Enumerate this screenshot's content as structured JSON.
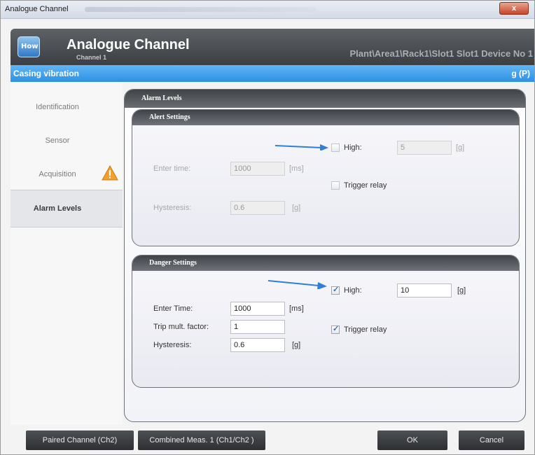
{
  "window": {
    "title": "Analogue Channel",
    "close_label": "x"
  },
  "header": {
    "logo_text": "How",
    "title": "Analogue Channel",
    "subtitle": "Channel 1",
    "path": "Plant\\Area1\\Rack1\\Slot1 Slot1 Device No 1"
  },
  "strip": {
    "left": "Casing vibration",
    "right": "g (P)"
  },
  "sidebar": {
    "items": [
      {
        "label": "Identification"
      },
      {
        "label": "Sensor"
      },
      {
        "label": "Acquisition"
      },
      {
        "label": "Alarm Levels"
      }
    ]
  },
  "main": {
    "title": "Alarm Levels",
    "alert": {
      "title": "Alert Settings",
      "high_label": "High:",
      "high_value": "5",
      "high_unit": "[g]",
      "high_checked": false,
      "enter_time_label": "Enter time:",
      "enter_time_value": "1000",
      "enter_time_unit": "[ms]",
      "trigger_relay_label": "Trigger relay",
      "hysteresis_label": "Hysteresis:",
      "hysteresis_value": "0.6",
      "hysteresis_unit": "[g]"
    },
    "danger": {
      "title": "Danger Settings",
      "high_label": "High:",
      "high_value": "10",
      "high_unit": "[g]",
      "high_checked": true,
      "enter_time_label": "Enter Time:",
      "enter_time_value": "1000",
      "enter_time_unit": "[ms]",
      "trip_label": "Trip mult. factor:",
      "trip_value": "1",
      "trigger_relay_label": "Trigger relay",
      "trigger_relay_checked": true,
      "hysteresis_label": "Hysteresis:",
      "hysteresis_value": "0.6",
      "hysteresis_unit": "[g]"
    }
  },
  "footer": {
    "paired": "Paired Channel (Ch2)",
    "combined": "Combined Meas. 1 (Ch1/Ch2 )",
    "ok": "OK",
    "cancel": "Cancel"
  },
  "colors": {
    "accent_blue": "#2d90e2",
    "header_dark": "#3b3e42",
    "warning": "#f0a030",
    "arrow": "#2f7fd6"
  },
  "icons": {
    "warning": "warning-triangle-icon",
    "annotation_arrow": "arrow-right-icon"
  }
}
